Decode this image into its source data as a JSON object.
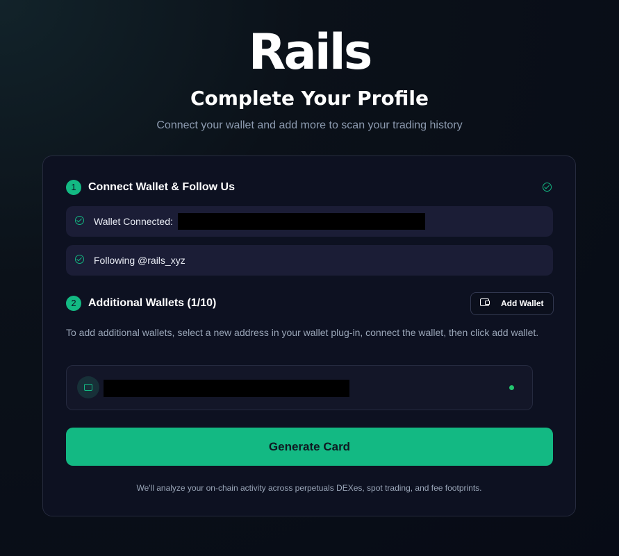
{
  "brand": {
    "logo_text": "Rails"
  },
  "header": {
    "title": "Complete Your Profile",
    "subtitle": "Connect your wallet and add more to scan your trading history"
  },
  "step1": {
    "number": "1",
    "title": "Connect Wallet & Follow Us",
    "completed": true,
    "wallet_connected_label": "Wallet Connected:",
    "following_label": "Following @rails_xyz"
  },
  "step2": {
    "number": "2",
    "title": "Additional Wallets (1/10)",
    "add_wallet_label": "Add Wallet",
    "helper_text": "To add additional wallets, select a new address in your wallet plug-in, connect the wallet, then click add wallet.",
    "wallets_count": 1,
    "wallets_max": 10
  },
  "actions": {
    "generate_label": "Generate Card"
  },
  "footer": {
    "note": "We'll analyze your on-chain activity across perpetuals DEXes, spot trading, and fee footprints."
  },
  "icons": [
    "check-circle-icon",
    "wallet-icon",
    "status-dot-icon"
  ],
  "colors": {
    "accent": "#13b983",
    "background": "#0b1020",
    "card": "#0d1121",
    "row": "#1b1d36",
    "online": "#23c56f"
  }
}
